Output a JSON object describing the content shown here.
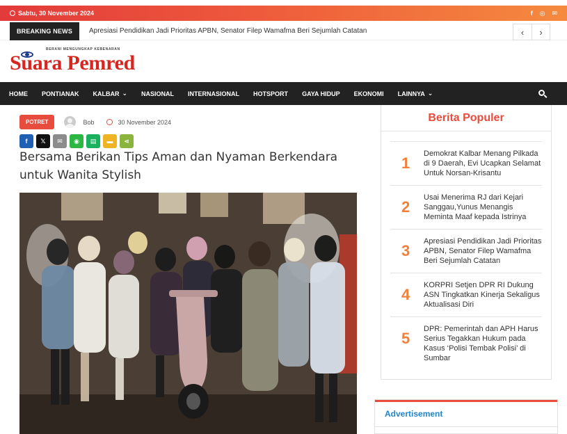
{
  "topbar": {
    "date": "Sabtu, 30 November 2024",
    "social": [
      "f",
      "◎",
      "✉"
    ]
  },
  "breaking": {
    "label": "BREAKING NEWS",
    "headline": "Apresiasi Pendidikan Jadi Prioritas APBN, Senator Filep Wamafma Beri Sejumlah Catatan",
    "prev": "‹",
    "next": "›"
  },
  "logo": {
    "tagline": "BERANI MENGUNGKAP KEBENARAN",
    "name": "Suara Pemred"
  },
  "nav": {
    "items": [
      "HOME",
      "PONTIANAK",
      "KALBAR",
      "NASIONAL",
      "INTERNASIONAL",
      "HOTSPORT",
      "GAYA HIDUP",
      "EKONOMI",
      "LAINNYA"
    ]
  },
  "article": {
    "category": "POTRET",
    "author": "Bob",
    "date": "30 November 2024",
    "title": "Bersama Berikan Tips Aman dan Nyaman Berkendara untuk Wanita Stylish",
    "share": [
      {
        "icon": "f",
        "color": "#1f5fb4"
      },
      {
        "icon": "𝕏",
        "color": "#111111"
      },
      {
        "icon": "✉",
        "color": "#8c8c8c"
      },
      {
        "icon": "◉",
        "color": "#2bb741"
      },
      {
        "icon": "▤",
        "color": "#19b05e"
      },
      {
        "icon": "▬",
        "color": "#f0b323"
      },
      {
        "icon": "⋖",
        "color": "#8bb43c"
      }
    ]
  },
  "sidebar": {
    "title": "Berita Populer",
    "items": [
      {
        "rank": "1",
        "title": "Demokrat Kalbar Menang Pilkada di 9 Daerah, Evi Ucapkan Selamat Untuk Norsan-Krisantu"
      },
      {
        "rank": "2",
        "title": "Usai Menerima RJ dari Kejari Sanggau,Yunus Menangis Meminta Maaf kepada Istrinya"
      },
      {
        "rank": "3",
        "title": "Apresiasi Pendidikan Jadi Prioritas APBN, Senator Filep Wamafma Beri Sejumlah Catatan"
      },
      {
        "rank": "4",
        "title": "KORPRI Setjen DPR RI Dukung ASN Tingkatkan Kinerja Sekaligus Aktualisasi Diri"
      },
      {
        "rank": "5",
        "title": "DPR: Pemerintah dan APH Harus Serius Tegakkan Hukum pada Kasus ‘Polisi Tembak Polisi’ di Sumbar"
      }
    ]
  },
  "ad": {
    "label": "Advertisement"
  }
}
